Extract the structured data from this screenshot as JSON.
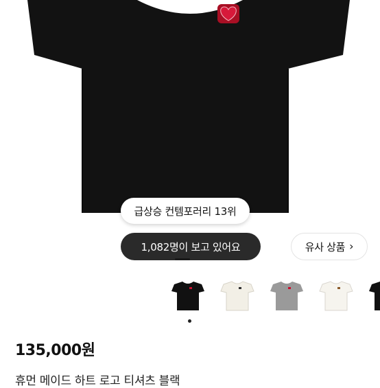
{
  "product": {
    "ranking_badge": "급상승 컨템포러리 13위",
    "viewers": "1,082명이 보고 있어요",
    "similar_button": "유사 상품",
    "price": "135,000원",
    "title": "휴먼 메이드 하트 로고 티셔츠 블랙"
  },
  "colors": {
    "shirt_main": "#111111",
    "logo_red": "#c8102e",
    "thumbnail_colors": [
      "#111111",
      "#f2efe6",
      "#9a9a9a",
      "#f6f4ee",
      "#111111"
    ]
  },
  "thumbnails": [
    {
      "name": "black",
      "color": "#111111"
    },
    {
      "name": "cream",
      "color": "#f2efe6"
    },
    {
      "name": "gray",
      "color": "#9a9a9a"
    },
    {
      "name": "white",
      "color": "#f6f4ee"
    },
    {
      "name": "black-2",
      "color": "#111111"
    }
  ],
  "icons": {
    "similar_chevron": "chevron-right-icon"
  }
}
